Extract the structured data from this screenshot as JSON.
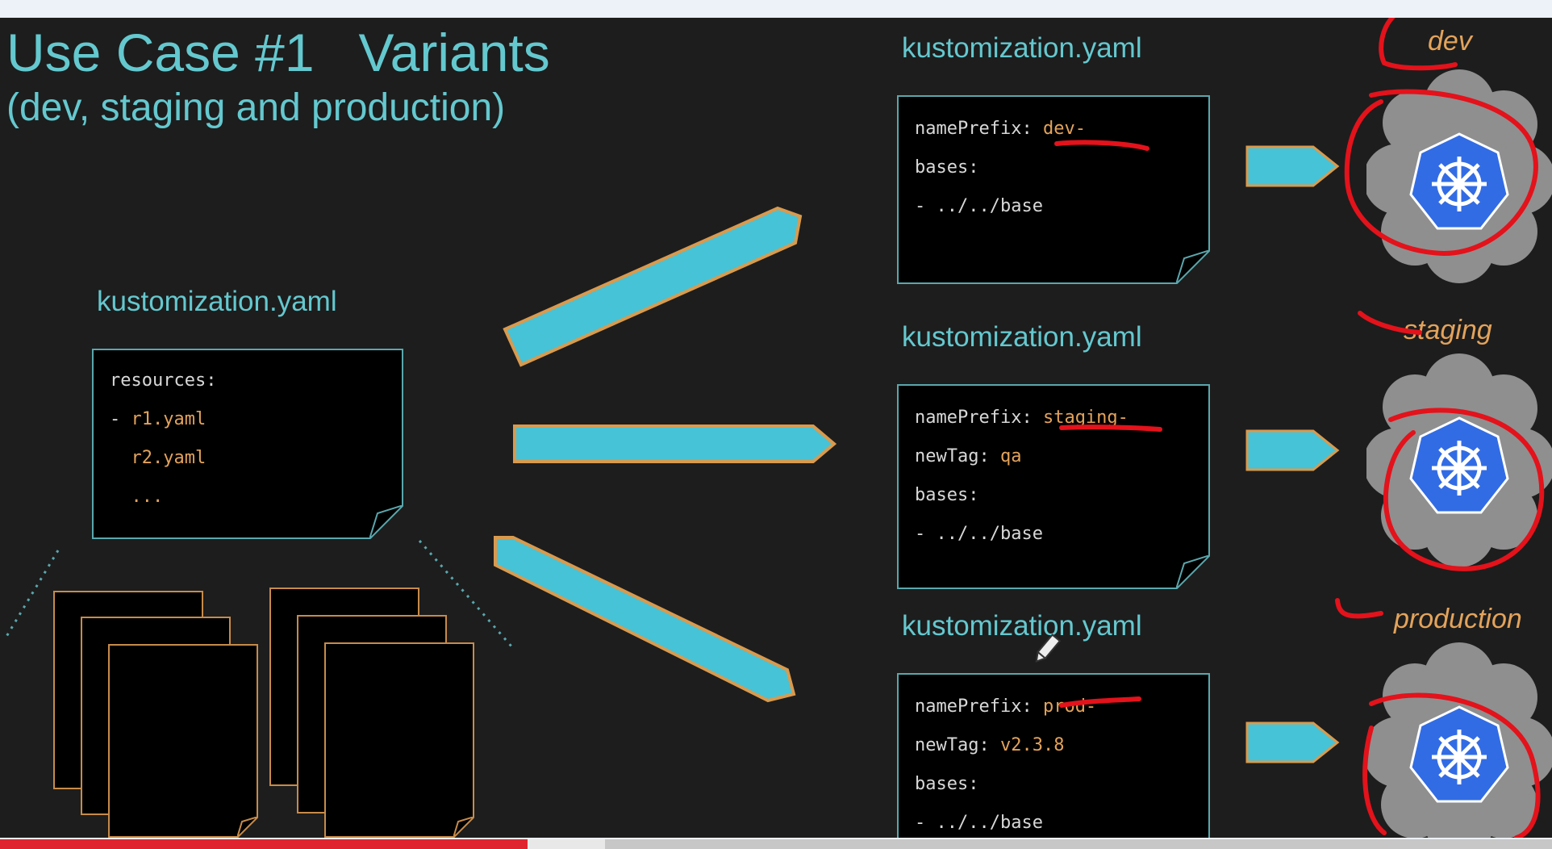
{
  "slide": {
    "title": "Use Case #1   Variants",
    "subtitle": "(dev, staging and production)",
    "base": {
      "label": "kustomization.yaml",
      "lines": [
        {
          "key": "resources:",
          "value": ""
        },
        {
          "key": "- ",
          "value": "r1.yaml"
        },
        {
          "key": "  ",
          "value": "r2.yaml"
        },
        {
          "key": "  ",
          "value": "..."
        }
      ]
    },
    "variants": [
      {
        "label": "kustomization.yaml",
        "env": "dev",
        "lines": [
          {
            "key": "namePrefix: ",
            "value": "dev-"
          },
          {
            "key": "bases:",
            "value": ""
          },
          {
            "key": "- ../../base",
            "value": ""
          }
        ]
      },
      {
        "label": "kustomization.yaml",
        "env": "staging",
        "lines": [
          {
            "key": "namePrefix: ",
            "value": "staging-"
          },
          {
            "key": "newTag: ",
            "value": "qa"
          },
          {
            "key": "bases:",
            "value": ""
          },
          {
            "key": "- ../../base",
            "value": ""
          }
        ]
      },
      {
        "label": "kustomization.yaml",
        "env": "production",
        "lines": [
          {
            "key": "namePrefix: ",
            "value": "prod-"
          },
          {
            "key": "newTag: ",
            "value": "v2.3.8"
          },
          {
            "key": "bases:",
            "value": ""
          },
          {
            "key": "- ../../base",
            "value": ""
          }
        ]
      }
    ]
  },
  "video": {
    "progress_fraction": 0.34,
    "buffered_fraction": 0.39
  },
  "colors": {
    "background": "#1d1d1d",
    "teal_text": "#64c8cf",
    "orange_value": "#e3a35b",
    "arrow_fill": "#46c3d6",
    "arrow_outline": "#d99a4e",
    "kubernetes_blue": "#326ce5",
    "annotation_red": "#e3121b",
    "progress_red": "#e0242f"
  }
}
